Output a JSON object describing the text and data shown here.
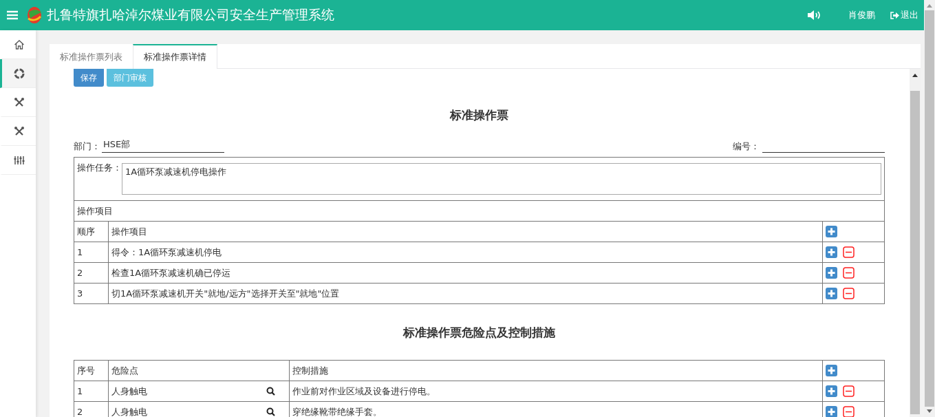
{
  "header": {
    "title": "扎鲁特旗扎哈淖尔煤业有限公司安全生产管理系统",
    "user": "肖俊鹏",
    "logout": "退出"
  },
  "sidebar": {
    "items": [
      {
        "kind": "home",
        "selected": false
      },
      {
        "kind": "target",
        "selected": true
      },
      {
        "kind": "tools",
        "selected": false
      },
      {
        "kind": "tools",
        "selected": false
      },
      {
        "kind": "sliders",
        "selected": false
      }
    ]
  },
  "tabs": [
    {
      "label": "标准操作票列表",
      "selected": false
    },
    {
      "label": "标准操作票详情",
      "selected": true
    }
  ],
  "buttons": [
    {
      "label": "保存",
      "kind": "primary"
    },
    {
      "label": "部门审核",
      "kind": "info"
    }
  ],
  "form": {
    "title": "标准操作票",
    "department_label": "部门：",
    "department": "HSE部",
    "number_label": "编号：",
    "task_label": "操作任务：",
    "task": "1A循环泵减速机停电操作"
  },
  "items_table": {
    "caption": "操作项目",
    "columns": [
      "顺序",
      "操作项目"
    ],
    "rows": [
      {
        "no": "1",
        "text": "得令：1A循环泵减速机停电"
      },
      {
        "no": "2",
        "text": "检查1A循环泵减速机确已停运"
      },
      {
        "no": "3",
        "text": "切1A循环泵减速机开关\"就地/远方\"选择开关至\"就地\"位置"
      }
    ]
  },
  "hazards": {
    "title": "标准操作票危险点及控制措施",
    "columns": [
      "序号",
      "危险点",
      "控制措施"
    ],
    "rows": [
      {
        "no": "1",
        "hazard": "人身触电",
        "measure": "作业前对作业区域及设备进行停电。"
      },
      {
        "no": "2",
        "hazard": "人身触电",
        "measure": "穿绝缘靴带绝缘手套。"
      }
    ]
  }
}
